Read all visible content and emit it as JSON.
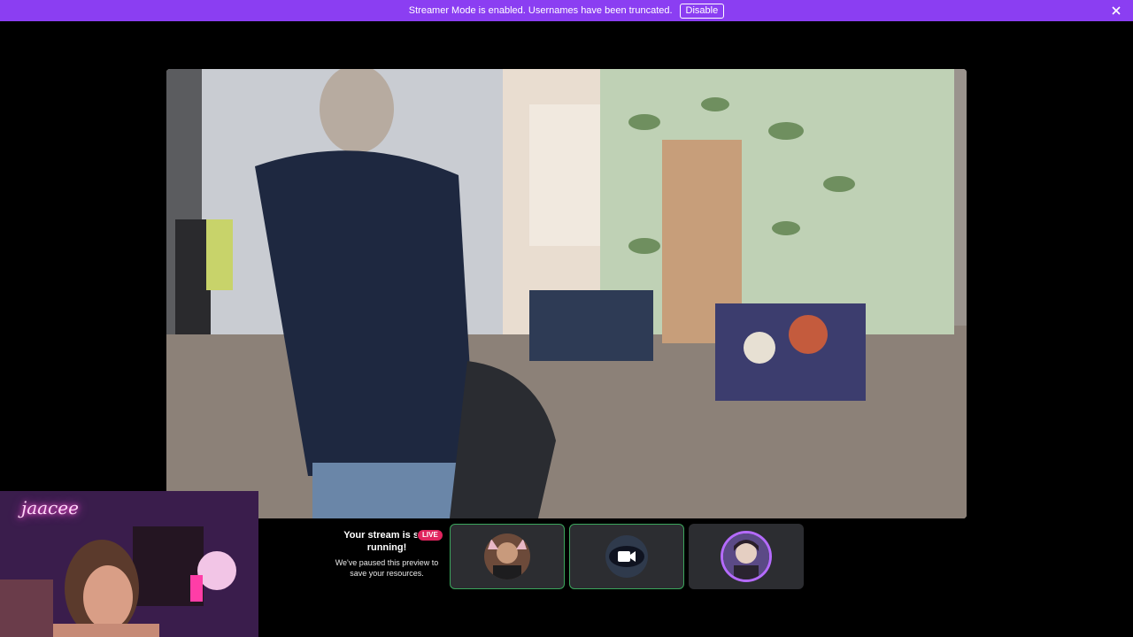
{
  "banner": {
    "message": "Streamer Mode is enabled. Usernames have been truncated.",
    "disable_label": "Disable"
  },
  "selfcam": {
    "neon_sign": "jaacee"
  },
  "stream_notice": {
    "title": "Your stream is still running!",
    "subtitle": "We've paused this preview to save your resources.",
    "live_badge": "LIVE"
  },
  "colors": {
    "banner": "#8b3ef2",
    "live": "#e0245e",
    "speaking_border": "#3ba55c",
    "tile_bg": "#2c2d31"
  },
  "tiles": [
    {
      "icon": "avatar-icon",
      "state": "speaking"
    },
    {
      "icon": "video-camera-icon",
      "state": "speaking"
    },
    {
      "icon": "avatar-icon",
      "state": "idle"
    }
  ]
}
